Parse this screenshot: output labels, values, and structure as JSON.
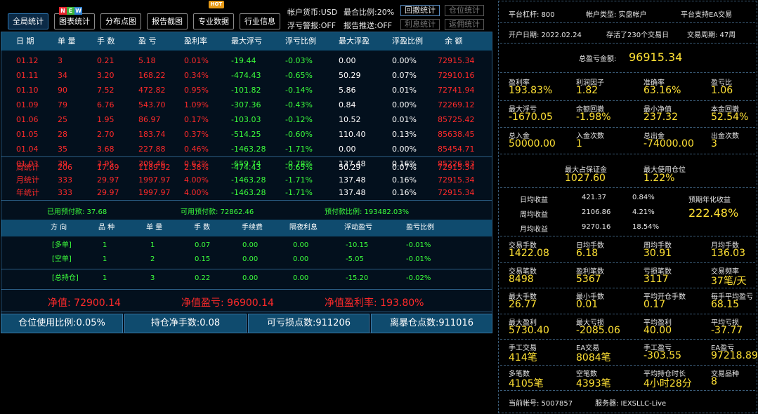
{
  "toolbar": {
    "buttons": [
      "全局统计",
      "图表统计",
      "分布点图",
      "报告截图",
      "专业数据",
      "行业信息"
    ],
    "new_badge": [
      "N",
      "E",
      "W"
    ],
    "hot_badge": "HOT",
    "account_currency": "帐户货币:USD",
    "max_ratio": "最合比例:20%",
    "float_alert": "浮亏警报:OFF",
    "report_push": "报告推送:OFF",
    "small_buttons": [
      "回撤统计",
      "仓位统计",
      "利息统计",
      "返佣统计"
    ]
  },
  "table": {
    "headers": [
      "日 期",
      "单 量",
      "手 数",
      "盈 亏",
      "盈利率",
      "最大浮亏",
      "浮亏比例",
      "最大浮盈",
      "浮盈比例",
      "余 额"
    ],
    "rows": [
      [
        "01.12",
        "3",
        "0.21",
        "5.18",
        "0.01%",
        "-19.44",
        "-0.03%",
        "0.00",
        "0.00%",
        "72915.34"
      ],
      [
        "01.11",
        "34",
        "3.20",
        "168.22",
        "0.34%",
        "-474.43",
        "-0.65%",
        "50.29",
        "0.07%",
        "72910.16"
      ],
      [
        "01.10",
        "90",
        "7.52",
        "472.82",
        "0.95%",
        "-101.82",
        "-0.14%",
        "5.86",
        "0.01%",
        "72741.94"
      ],
      [
        "01.09",
        "79",
        "6.76",
        "543.70",
        "1.09%",
        "-307.36",
        "-0.43%",
        "0.84",
        "0.00%",
        "72269.12"
      ],
      [
        "01.06",
        "25",
        "1.95",
        "86.97",
        "0.17%",
        "-103.03",
        "-0.12%",
        "10.52",
        "0.01%",
        "85725.42"
      ],
      [
        "01.05",
        "28",
        "2.70",
        "183.74",
        "0.37%",
        "-514.25",
        "-0.60%",
        "110.40",
        "0.13%",
        "85638.45"
      ],
      [
        "01.04",
        "35",
        "3.68",
        "227.88",
        "0.46%",
        "-1463.28",
        "-1.71%",
        "0.00",
        "0.00%",
        "85454.71"
      ],
      [
        "01.03",
        "39",
        "3.95",
        "309.46",
        "0.62%",
        "-659.74",
        "-0.78%",
        "137.48",
        "0.16%",
        "85226.83"
      ]
    ],
    "summary": [
      [
        "周统计",
        "206",
        "17.69",
        "1189.92",
        "2.38%",
        "-474.43",
        "-0.65%",
        "50.29",
        "0.07%",
        "72915.34"
      ],
      [
        "月统计",
        "333",
        "29.97",
        "1997.97",
        "4.00%",
        "-1463.28",
        "-1.71%",
        "137.48",
        "0.16%",
        "72915.34"
      ],
      [
        "年统计",
        "333",
        "29.97",
        "1997.97",
        "4.00%",
        "-1463.28",
        "-1.71%",
        "137.48",
        "0.16%",
        "72915.34"
      ]
    ]
  },
  "margin": {
    "used": "已用预付款: 37.68",
    "available": "可用预付款: 72862.46",
    "ratio": "预付款比例: 193482.03%"
  },
  "positions": {
    "headers": [
      "方 向",
      "品 种",
      "单 量",
      "手 数",
      "手续费",
      "隔夜利息",
      "浮动盈亏",
      "盈亏比例"
    ],
    "rows": [
      [
        "[多单]",
        "1",
        "1",
        "0.07",
        "0.00",
        "0.00",
        "-10.15",
        "-0.01%"
      ],
      [
        "[空单]",
        "1",
        "2",
        "0.15",
        "0.00",
        "0.00",
        "-5.05",
        "-0.01%"
      ]
    ],
    "total": [
      "[总持仓]",
      "1",
      "3",
      "0.22",
      "0.00",
      "0.00",
      "-15.20",
      "-0.02%"
    ]
  },
  "net": {
    "equity": "净值: 72900.14",
    "equity_pl": "净值盈亏: 96900.14",
    "equity_rate": "净值盈利率: 193.80%"
  },
  "footer": [
    "仓位使用比例:0.05%",
    "持仓净手数:0.08",
    "可亏损点数:911206",
    "离暴仓点数:911016"
  ],
  "right": {
    "leverage": "平台杠杆:   800",
    "account_type": "帐户类型:   实盘帐户",
    "platform": "平台支持EA交易",
    "open_date": "开户日期:  2022.02.24",
    "alive": "存活了230个交易日",
    "cycle": "交易周期:  47周",
    "total_pl_label": "总盈亏金额:",
    "total_pl_value": "96915.34",
    "grid1": [
      [
        "盈利率",
        "193.83%"
      ],
      [
        "利润因子",
        "1.82"
      ],
      [
        "准确率",
        "63.16%"
      ],
      [
        "盈亏比",
        "1.06"
      ],
      [
        "最大浮亏",
        "-1670.05"
      ],
      [
        "余额回撤",
        "-1.98%"
      ],
      [
        "最小净值",
        "237.32"
      ],
      [
        "本金回撤",
        "52.54%"
      ],
      [
        "总入金",
        "50000.00"
      ],
      [
        "入金次数",
        "1"
      ],
      [
        "总出金",
        "-74000.00"
      ],
      [
        "出金次数",
        "3"
      ]
    ],
    "max_margin_label": "最大占保证金",
    "max_margin_value": "1027.60",
    "max_pos_label": "最大使用仓位",
    "max_pos_value": "1.22%",
    "income": [
      [
        "日均收益",
        "421.37",
        "0.84%"
      ],
      [
        "周均收益",
        "2106.86",
        "4.21%"
      ],
      [
        "月均收益",
        "9270.16",
        "18.54%"
      ]
    ],
    "annual_label": "预期年化收益",
    "annual_value": "222.48%",
    "grid2": [
      [
        "交易手数",
        "1422.08"
      ],
      [
        "日均手数",
        "6.18"
      ],
      [
        "周均手数",
        "30.91"
      ],
      [
        "月均手数",
        "136.03"
      ],
      [
        "交易笔数",
        "8498"
      ],
      [
        "盈利笔数",
        "5367"
      ],
      [
        "亏损笔数",
        "3117"
      ],
      [
        "交易频率",
        "37笔/天"
      ],
      [
        "最大手数",
        "26.77"
      ],
      [
        "最小手数",
        "0.01"
      ],
      [
        "平均开仓手数",
        "0.17"
      ],
      [
        "每手平均盈亏",
        "68.15"
      ],
      [
        "最大盈利",
        "5730.40"
      ],
      [
        "最大亏损",
        "-2085.06"
      ],
      [
        "平均盈利",
        "40.00"
      ],
      [
        "平均亏损",
        "-37.77"
      ],
      [
        "手工交易",
        "414笔"
      ],
      [
        "EA交易",
        "8084笔"
      ],
      [
        "手工盈亏",
        "-303.55"
      ],
      [
        "EA盈亏",
        "97218.89"
      ],
      [
        "多笔数",
        "4105笔"
      ],
      [
        "空笔数",
        "4393笔"
      ],
      [
        "平均持仓时长",
        "4小时28分"
      ],
      [
        "交易品种",
        "8"
      ]
    ],
    "account_no": "当前帐号:  5007857",
    "server": "服务器:  IEXSLLC-Live"
  },
  "colors": {
    "header_bg": "#0f4b6e",
    "loss": "#ff2a2a",
    "profit": "#3cff3c",
    "value": "#ffe135"
  }
}
